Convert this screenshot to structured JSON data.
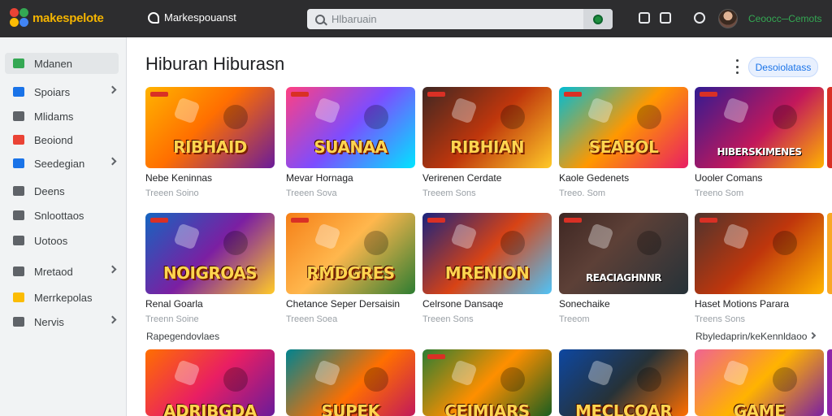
{
  "header": {
    "brand": "makespelote",
    "store_label": "Markespouanst",
    "search_placeholder": "Hlbaruain",
    "account_name": "Ceoocc─Cemots"
  },
  "sidebar": {
    "items": [
      {
        "label": "Mdanen",
        "icon": "home-icon",
        "color": "#34a853",
        "chevron": false,
        "active": true
      },
      {
        "label": "Spoiars",
        "icon": "home-icon",
        "color": "#1a73e8",
        "chevron": true,
        "active": false
      },
      {
        "label": "Mlidams",
        "icon": "clock-icon",
        "color": "#5f6368",
        "chevron": false,
        "active": false
      },
      {
        "label": "Beoiond",
        "icon": "bookmark-icon",
        "color": "#ea4335",
        "chevron": false,
        "active": false
      },
      {
        "label": "Seedegian",
        "icon": "window-icon",
        "color": "#1a73e8",
        "chevron": true,
        "active": false
      },
      {
        "label": "Deens",
        "icon": "gift-icon",
        "color": "#5f6368",
        "chevron": false,
        "active": false
      },
      {
        "label": "Snloottaos",
        "icon": "tag-icon",
        "color": "#5f6368",
        "chevron": false,
        "active": false
      },
      {
        "label": "Uotoos",
        "icon": "film-icon",
        "color": "#5f6368",
        "chevron": false,
        "active": false
      },
      {
        "label": "Mretaod",
        "icon": "gift-icon",
        "color": "#5f6368",
        "chevron": true,
        "active": false
      },
      {
        "label": "Merrkepolas",
        "icon": "apps-icon",
        "color": "#fbbc04",
        "chevron": false,
        "active": false
      },
      {
        "label": "Nervis",
        "icon": "gear-icon",
        "color": "#5f6368",
        "chevron": true,
        "active": false
      }
    ]
  },
  "main": {
    "title": "Hiburan Hiburasn",
    "pill_label": "Desoiolatass",
    "section_label": "Rapegendovlaes",
    "see_more_label": "Rbyledaprin/keKennldaoo",
    "row1": [
      {
        "title": "Nebe Keninnas",
        "sub": "Treeen Soino",
        "art": "RIBHAID"
      },
      {
        "title": "Mevar Hornaga",
        "sub": "Treeen Sova",
        "art": "SUANAA"
      },
      {
        "title": "Verirenen Cerdate",
        "sub": "Treeem Sons",
        "art": "RIBHIAN"
      },
      {
        "title": "Kaole Gedenets",
        "sub": "Treeo. Som",
        "art": "SEABOL"
      },
      {
        "title": "Uooler Comans",
        "sub": "Treeno Som",
        "art": "HIBERSKIMENES"
      }
    ],
    "row2": [
      {
        "title": "Renal Goarla",
        "sub": "Treenn Soine",
        "art": "NOIGROAS"
      },
      {
        "title": "Chetance Seper Dersaisin",
        "sub": "Treeen Soea",
        "art": "RMDGRES"
      },
      {
        "title": "Celrsone Dansaqe",
        "sub": "Treeen Sons",
        "art": "MRENION"
      },
      {
        "title": "Sonechaike",
        "sub": "Treeom",
        "art": "REACIAGHNNR"
      },
      {
        "title": "Haset Motions Parara",
        "sub": "Treens Sons",
        "art": ""
      }
    ],
    "row3": [
      {
        "art": "ADRIBGDA"
      },
      {
        "art": "SUPEK"
      },
      {
        "art": "CEIMIARS"
      },
      {
        "art": "MECLCOAR"
      },
      {
        "art": "GAME"
      }
    ]
  }
}
